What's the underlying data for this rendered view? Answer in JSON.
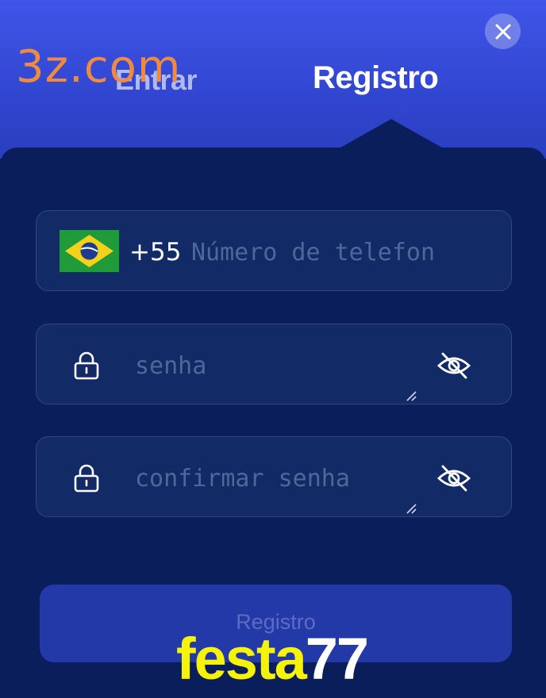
{
  "header": {
    "tabs": [
      {
        "label": "Entrar",
        "active": false
      },
      {
        "label": "Registro",
        "active": true
      }
    ],
    "close_icon": "close-icon"
  },
  "form": {
    "phone": {
      "country_flag": "brazil-flag-icon",
      "country_code": "+55",
      "placeholder": "Número de telefon",
      "value": ""
    },
    "password": {
      "placeholder": "senha",
      "value": "",
      "lock_icon": "lock-icon",
      "toggle_icon": "eye-slash-icon"
    },
    "confirm_password": {
      "placeholder": "confirmar senha",
      "value": "",
      "lock_icon": "lock-icon",
      "toggle_icon": "eye-slash-icon"
    },
    "submit_label": "Registro"
  },
  "watermarks": {
    "top": "3z.com",
    "bottom_part1": "festa",
    "bottom_part2": "77"
  },
  "colors": {
    "header_top": "#3f55e8",
    "panel": "#0b1e5c",
    "field_bg": "#122a66",
    "field_border": "#34467f",
    "button": "#2439a8",
    "watermark_orange": "#f08a3e",
    "watermark_yellow": "#f6f30a"
  }
}
